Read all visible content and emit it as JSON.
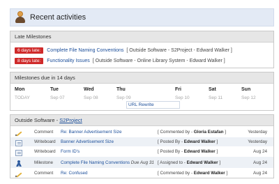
{
  "header": {
    "title": "Recent activities"
  },
  "late": {
    "title": "Late Milestones",
    "items": [
      {
        "badge": "6 days late:",
        "link": "Complete File Naming Conventions",
        "meta": "[ Outside Software - S2Project - Edward Walker ]"
      },
      {
        "badge": "8 days late:",
        "link": "Functionality Issues",
        "meta": "[ Outside Software - Online Library System - Edward Walker ]"
      }
    ]
  },
  "due": {
    "title": "Milestones due in 14 days",
    "days": [
      {
        "day": "Mon",
        "date": "TODAY"
      },
      {
        "day": "Tue",
        "date": "Sep 07"
      },
      {
        "day": "Wed",
        "date": "Sep 08"
      },
      {
        "day": "Thu",
        "date": "Sep 09"
      },
      {
        "day": "Fri",
        "date": "Sep 10"
      },
      {
        "day": "Sat",
        "date": "Sep 11"
      },
      {
        "day": "Sun",
        "date": "Sep 12"
      }
    ],
    "event": "URL Rewrite"
  },
  "project": {
    "company": "Outside Software",
    "separator": " - ",
    "name": "S2Project",
    "activities": [
      {
        "icon": "pencil-icon",
        "type": "Comment",
        "link": "Re: Banner Advertisement Size",
        "due": "",
        "meta_prefix": "[ Commented by - ",
        "meta_user": "Gloria Estafan",
        "meta_suffix": " ]",
        "date": "Yesterday"
      },
      {
        "icon": "writeboard-icon",
        "type": "Writeboard",
        "link": "Banner Advertisement Size",
        "due": "",
        "meta_prefix": "[ Posted By - ",
        "meta_user": "Edward Walker",
        "meta_suffix": " ]",
        "date": "Yesterday"
      },
      {
        "icon": "writeboard-icon",
        "type": "Writeboard",
        "link": "Form ID's",
        "due": "",
        "meta_prefix": "[ Posted By - ",
        "meta_user": "Edward Walker",
        "meta_suffix": " ]",
        "date": "Aug 24"
      },
      {
        "icon": "milestone-icon",
        "type": "Milestone",
        "link": "Complete File Naming Conventions",
        "due": "Due Aug 31",
        "meta_prefix": "[ Assigned to - ",
        "meta_user": "Edward Walker",
        "meta_suffix": " ]",
        "date": "Aug 24"
      },
      {
        "icon": "pencil-icon",
        "type": "Comment",
        "link": "Re: Confused",
        "due": "",
        "meta_prefix": "[ Commented by - ",
        "meta_user": "Edward Walker",
        "meta_suffix": " ]",
        "date": "Aug 24"
      }
    ]
  }
}
